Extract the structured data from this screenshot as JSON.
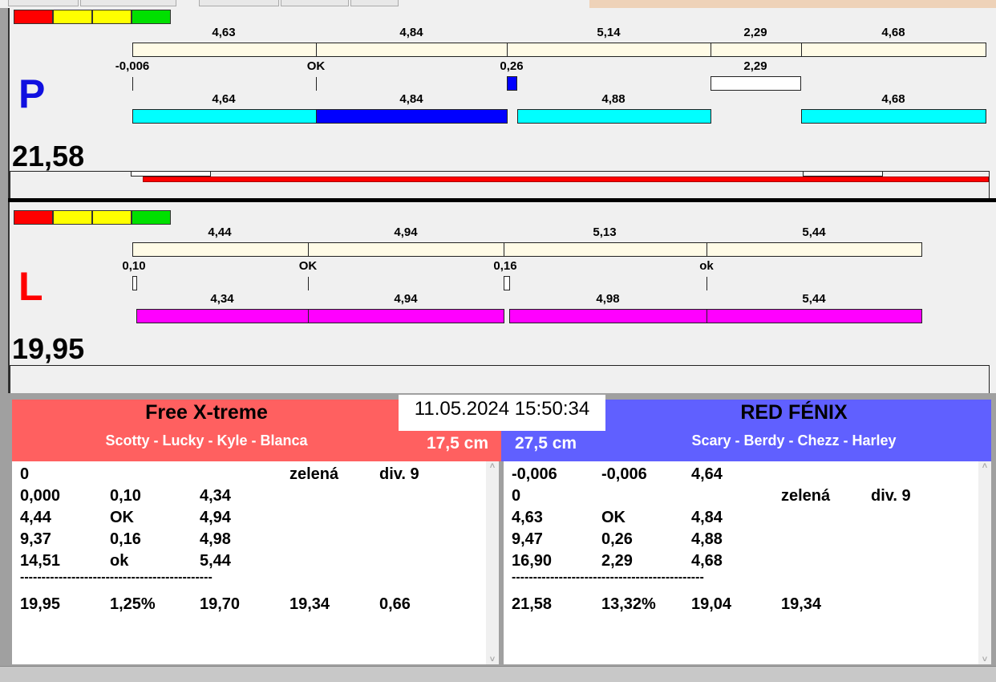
{
  "right_team": {
    "letter": "P",
    "total": "21,58",
    "top_labels": [
      "4,63",
      "4,84",
      "5,14",
      "2,29",
      "4,68"
    ],
    "mid_labels": [
      "-0,006",
      "OK",
      "0,26",
      "2,29"
    ],
    "bottom_labels": [
      "4,64",
      "4,84",
      "4,88",
      "4,68"
    ]
  },
  "left_team": {
    "letter": "L",
    "total": "19,95",
    "top_labels": [
      "4,44",
      "4,94",
      "5,13",
      "5,44"
    ],
    "mid_labels": [
      "0,10",
      "OK",
      "0,16",
      "ok"
    ],
    "bottom_labels": [
      "4,34",
      "4,94",
      "4,98",
      "5,44"
    ]
  },
  "datetime": "11.05.2024 15:50:34",
  "team_a": {
    "name": "Free X-treme",
    "members": "Scotty - Lucky - Kyle - Blanca",
    "distance": "17,5 cm",
    "rows": [
      [
        "0",
        "",
        "",
        "zelená",
        "div. 9"
      ],
      [
        "0,000",
        "0,10",
        "4,34",
        "",
        ""
      ],
      [
        "4,44",
        "OK",
        "4,94",
        "",
        ""
      ],
      [
        "9,37",
        "0,16",
        "4,98",
        "",
        ""
      ],
      [
        "14,51",
        "ok",
        "5,44",
        "",
        ""
      ],
      [
        "---------------------------------------------",
        "",
        "",
        "",
        ""
      ],
      [
        "19,95",
        "1,25%",
        "19,70",
        "19,34",
        "0,66"
      ]
    ]
  },
  "team_b": {
    "name": "RED FÉNIX",
    "members": "Scary - Berdy - Chezz - Harley",
    "distance": "27,5 cm",
    "rows": [
      [
        "-0,006",
        "-0,006",
        "4,64",
        "",
        ""
      ],
      [
        "0",
        "",
        "",
        "zelená",
        "div. 9"
      ],
      [
        "4,63",
        "OK",
        "4,84",
        "",
        ""
      ],
      [
        "9,47",
        "0,26",
        "4,88",
        "",
        ""
      ],
      [
        "16,90",
        "2,29",
        "4,68",
        "",
        ""
      ],
      [
        "---------------------------------------------",
        "",
        "",
        "",
        ""
      ],
      [
        "21,58",
        "13,32%",
        "19,04",
        "19,34",
        ""
      ]
    ]
  },
  "colors": {
    "red": "#ff0000",
    "yellow": "#ffff00",
    "green": "#00e000",
    "team_a_bg": "#ff6060",
    "team_b_bg": "#6060ff"
  }
}
